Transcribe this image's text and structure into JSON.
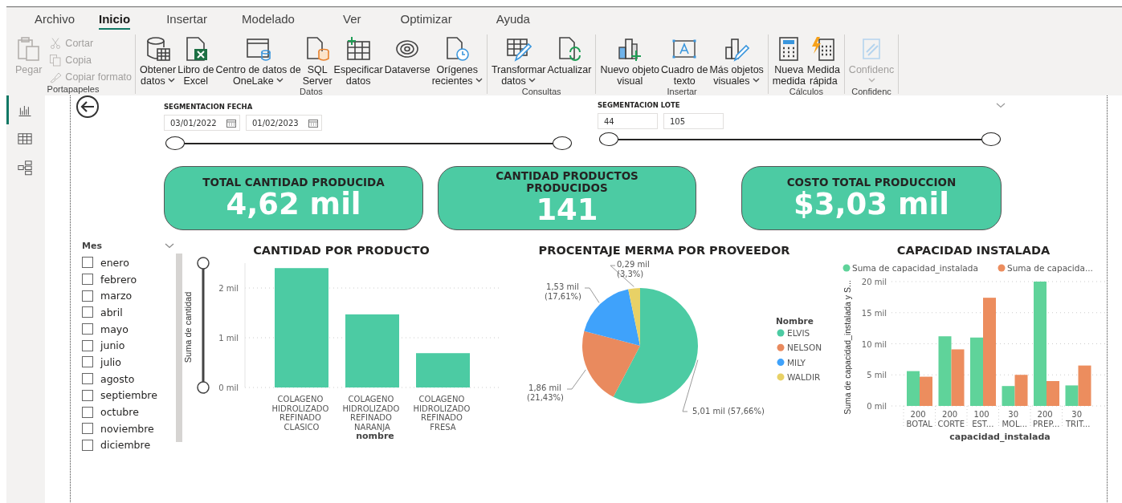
{
  "ribbon_tabs": [
    {
      "label": "Archivo",
      "selected": false
    },
    {
      "label": "Inicio",
      "selected": true
    },
    {
      "label": "Insertar",
      "selected": false
    },
    {
      "label": "Modelado",
      "selected": false
    },
    {
      "label": "Ver",
      "selected": false
    },
    {
      "label": "Optimizar",
      "selected": false
    },
    {
      "label": "Ayuda",
      "selected": false
    }
  ],
  "ribbon_groups": [
    {
      "label": "Portapapeles",
      "buttons": [
        {
          "label": "Pegar",
          "kind": "paste",
          "dropdown": false,
          "disabled": true
        }
      ],
      "small_buttons": [
        {
          "label": "Cortar",
          "kind": "cut",
          "disabled": true
        },
        {
          "label": "Copia",
          "kind": "copy",
          "disabled": true
        },
        {
          "label": "Copiar formato",
          "kind": "painter",
          "disabled": true
        }
      ]
    },
    {
      "label": "Datos",
      "buttons": [
        {
          "label": "Obtener datos",
          "kind": "database",
          "dropdown": true,
          "disabled": false
        },
        {
          "label": "Libro de Excel",
          "kind": "excel",
          "dropdown": false,
          "disabled": false
        },
        {
          "label": "Centro de datos de OneLake",
          "kind": "onelake",
          "dropdown": true,
          "disabled": false
        },
        {
          "label": "SQL Server",
          "kind": "sql",
          "dropdown": false,
          "disabled": false
        },
        {
          "label": "Especificar datos",
          "kind": "enter",
          "dropdown": false,
          "disabled": false
        },
        {
          "label": "Dataverse",
          "kind": "dataverse",
          "dropdown": false,
          "disabled": false
        },
        {
          "label": "Orígenes recientes",
          "kind": "recent",
          "dropdown": true,
          "disabled": false
        }
      ]
    },
    {
      "label": "Consultas",
      "buttons": [
        {
          "label": "Transformar datos",
          "kind": "transform",
          "dropdown": true,
          "disabled": false
        },
        {
          "label": "Actualizar",
          "kind": "refresh",
          "dropdown": false,
          "disabled": false
        }
      ]
    },
    {
      "label": "Insertar",
      "buttons": [
        {
          "label": "Nuevo objeto visual",
          "kind": "newvisual",
          "dropdown": false,
          "disabled": false
        },
        {
          "label": "Cuadro de texto",
          "kind": "textbox",
          "dropdown": false,
          "disabled": false
        },
        {
          "label": "Más objetos visuales",
          "kind": "morevisuals",
          "dropdown": true,
          "disabled": false
        }
      ]
    },
    {
      "label": "Cálculos",
      "buttons": [
        {
          "label": "Nueva medida",
          "kind": "calculator",
          "dropdown": false,
          "disabled": false
        },
        {
          "label": "Medida rápida",
          "kind": "quick",
          "dropdown": false,
          "disabled": false
        }
      ]
    },
    {
      "label": "Confidenc",
      "buttons": [
        {
          "label": "Confidenc",
          "kind": "sensitivity",
          "dropdown": true,
          "disabled": true
        }
      ]
    }
  ],
  "nav_items": [
    {
      "kind": "report",
      "selected": true
    },
    {
      "kind": "table",
      "selected": false
    },
    {
      "kind": "model",
      "selected": false
    }
  ],
  "slicer_fecha": {
    "title": "SEGMENTACION FECHA",
    "start": "03/01/2022",
    "end": "01/02/2023",
    "level": 1
  },
  "slicer_lote": {
    "title": "SEGMENTACION LOTE",
    "start": "44",
    "end": "105",
    "level": 1
  },
  "kpis": [
    {
      "title": "TOTAL CANTIDAD PRODUCIDA",
      "value": "4,62 mil"
    },
    {
      "title": "CANTIDAD PRODUCTOS PRODUCIDOS",
      "value": "141"
    },
    {
      "title": "COSTO TOTAL PRODUCCION",
      "value": "$3,03 mil"
    }
  ],
  "month_slicer": {
    "title": "Mes",
    "items": [
      {
        "label": "enero",
        "checked": false
      },
      {
        "label": "febrero",
        "checked": false
      },
      {
        "label": "marzo",
        "checked": false
      },
      {
        "label": "abril",
        "checked": false
      },
      {
        "label": "mayo",
        "checked": false
      },
      {
        "label": "junio",
        "checked": false
      },
      {
        "label": "julio",
        "checked": false
      },
      {
        "label": "agosto",
        "checked": false
      },
      {
        "label": "septiembre",
        "checked": false
      },
      {
        "label": "octubre",
        "checked": false
      },
      {
        "label": "noviembre",
        "checked": false
      },
      {
        "label": "diciembre",
        "checked": false
      }
    ]
  },
  "bar_visual": {
    "chart_data": {
      "type": "bar",
      "title": "CANTIDAD POR PRODUCTO",
      "xlabel": "nombre",
      "ylabel": "Suma de cantidad",
      "categories": [
        "COLAGENO HIDROLIZADO REFINADO CLASICO",
        "COLAGENO HIDROLIZADO REFINADO NARANJA",
        "COLAGENO HIDROLIZADO REFINADO FRESA"
      ],
      "series": [
        {
          "color": "#4ccba3",
          "values": [
            2.4,
            1.47,
            0.69
          ]
        }
      ],
      "ylim": [
        0,
        2.5
      ],
      "yticks": [
        {
          "value": 0,
          "label": "0 mil"
        },
        {
          "value": 1,
          "label": "1 mil"
        },
        {
          "value": 2,
          "label": "2 mil"
        }
      ],
      "grid": true
    }
  },
  "pie_visual": {
    "chart_data": {
      "type": "pie",
      "title": "PROCENTAJE MERMA POR PROVEEDOR",
      "categories": [
        "ELVIS",
        "NELSON",
        "MILY",
        "WALDIR"
      ],
      "series": [
        {
          "name": "Nombre",
          "values": [
            57.66,
            21.43,
            17.61,
            3.3
          ]
        }
      ],
      "value_labels": [
        "5,01 mil (57,66%)",
        "1,86 mil (21,43%)",
        "1,53 mil (17,61%)",
        "0,29 mil (3,3%)"
      ],
      "legend": true
    },
    "slice_colors": [
      {
        "color": "#4ccba3"
      },
      {
        "color": "#e98a5e"
      },
      {
        "color": "#3fa2fb"
      },
      {
        "color": "#e8d166"
      }
    ]
  },
  "capacity_visual": {
    "chart_data": {
      "type": "bar",
      "title": "CAPACIDAD INSTALADA",
      "xlabel": "capacidad_instalada",
      "ylabel": "Suma de capacidad_instalada y S...",
      "categories": [
        "200 BOTAL",
        "200 CORTE",
        "100 EST...",
        "30 MOL...",
        "200 PREP...",
        "30 TRIT..."
      ],
      "series": [
        {
          "name": "Suma de capacidad_instalada",
          "color": "#5fd39a",
          "values": [
            5.6,
            11.2,
            11.0,
            3.2,
            20.0,
            3.3
          ]
        },
        {
          "name": "Suma de capacida...",
          "color": "#ec8d5e",
          "values": [
            4.7,
            9.1,
            17.4,
            5.0,
            4.0,
            6.5
          ]
        }
      ],
      "ylim": [
        0,
        20
      ],
      "yticks": [
        {
          "value": 0,
          "label": "0 mil"
        },
        {
          "value": 5,
          "label": "5 mil"
        },
        {
          "value": 10,
          "label": "10 mil"
        },
        {
          "value": 15,
          "label": "15 mil"
        },
        {
          "value": 20,
          "label": "20 mil"
        }
      ],
      "grid": true,
      "legend": true
    }
  }
}
